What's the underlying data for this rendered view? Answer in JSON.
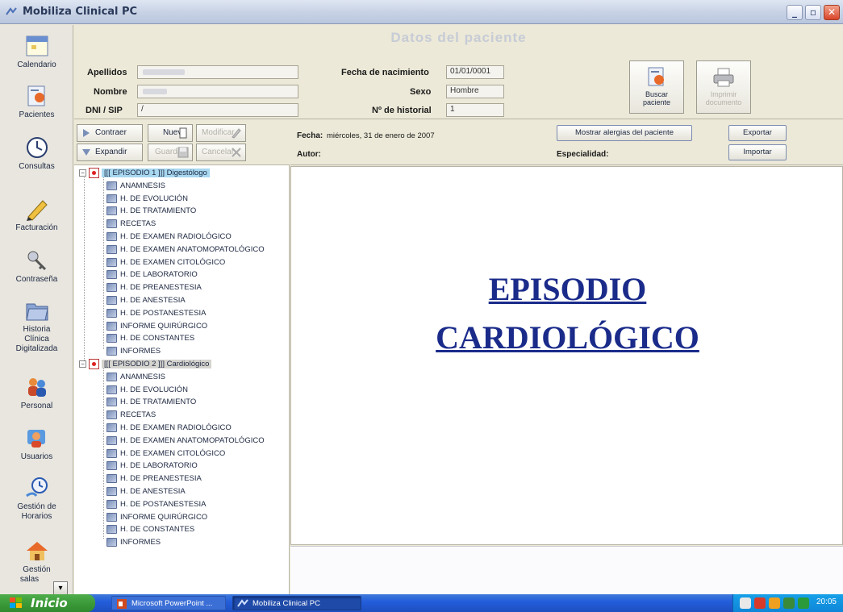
{
  "window": {
    "title": "Mobiliza Clinical PC",
    "controls": [
      "minimize",
      "maximize",
      "close"
    ]
  },
  "sidebar": {
    "items": [
      {
        "label": "Calendario",
        "icon": "calendar-icon"
      },
      {
        "label": "Pacientes",
        "icon": "patient-icon"
      },
      {
        "label": "Consultas",
        "icon": "clock-icon"
      },
      {
        "label": "Facturación",
        "icon": "pencil-icon"
      },
      {
        "label": "Contraseña",
        "icon": "keys-icon"
      },
      {
        "label": "Historia Clínica Digitalizada",
        "label_lines": [
          "Historia",
          "Clínica",
          "Digitalizada"
        ],
        "icon": "folder-icon"
      },
      {
        "label": "Personal",
        "icon": "people-icon"
      },
      {
        "label": "Usuarios",
        "icon": "users-icon"
      },
      {
        "label": "Gestión de Horarios",
        "label_lines": [
          "Gestión de",
          "Horarios"
        ],
        "icon": "schedule-icon"
      },
      {
        "label": "Gestión salas",
        "label_lines": [
          "Gestión",
          "salas"
        ],
        "icon": "house-icon"
      }
    ]
  },
  "patient": {
    "section_title": "Datos del paciente",
    "apellidos_label": "Apellidos",
    "nombre_label": "Nombre",
    "dni_label": "DNI / SIP",
    "dni_value": "/",
    "fecha_label": "Fecha de nacimiento",
    "fecha_value": "01/01/0001",
    "sexo_label": "Sexo",
    "sexo_value": "Hombre",
    "historial_label": "Nº de historial",
    "historial_value": "1",
    "buscar_label_1": "Buscar",
    "buscar_label_2": "paciente",
    "imprimir_label_1": "Imprimir",
    "imprimir_label_2": "documento"
  },
  "toolbar": {
    "contraer": "Contraer",
    "expandir": "Expandir",
    "nuevo": "Nuevo",
    "guardar": "Guardar",
    "modificar": "Modificar",
    "cancelar": "Cancelar"
  },
  "tree": {
    "episodes": [
      {
        "label": "[[[ EPISODIO 1 ]]]  Digestólogo",
        "children": [
          "ANAMNESIS",
          "H. DE EVOLUCIÓN",
          "H. DE TRATAMIENTO",
          "RECETAS",
          "H. DE EXAMEN RADIOLÓGICO",
          "H. DE EXAMEN ANATOMOPATOLÓGICO",
          "H. DE EXAMEN CITOLÓGICO",
          "H. DE LABORATORIO",
          "H. DE PREANESTESIA",
          "H. DE ANESTESIA",
          "H. DE POSTANESTESIA",
          "INFORME QUIRÚRGICO",
          "H. DE CONSTANTES",
          "INFORMES"
        ]
      },
      {
        "label": "[[[ EPISODIO 2 ]]]  Cardiológico",
        "children": [
          "ANAMNESIS",
          "H. DE EVOLUCIÓN",
          "H. DE TRATAMIENTO",
          "RECETAS",
          "H. DE EXAMEN RADIOLÓGICO",
          "H. DE EXAMEN ANATOMOPATOLÓGICO",
          "H. DE EXAMEN CITOLÓGICO",
          "H. DE LABORATORIO",
          "H. DE PREANESTESIA",
          "H. DE ANESTESIA",
          "H. DE POSTANESTESIA",
          "INFORME QUIRÚRGICO",
          "H. DE CONSTANTES",
          "INFORMES"
        ]
      }
    ]
  },
  "content": {
    "fecha_label": "Fecha:",
    "fecha_value": "miércoles, 31 de enero de 2007",
    "autor_label": "Autor:",
    "especialidad_label": "Especialidad:",
    "alergias_button": "Mostrar alergias del paciente",
    "exportar_button": "Exportar",
    "importar_button": "Importar",
    "heading_line1": "EPISODIO",
    "heading_line2": "CARDIOLÓGICO"
  },
  "taskbar": {
    "start_label": "Inicio",
    "tasks": [
      "Microsoft PowerPoint ...",
      "Mobiliza Clinical PC"
    ],
    "clock": "20:05"
  },
  "colors": {
    "heading": "#1a2b8a",
    "selected_node": "#a8d8f0",
    "taskbar": "#245edb",
    "start": "#3c9a3a"
  }
}
